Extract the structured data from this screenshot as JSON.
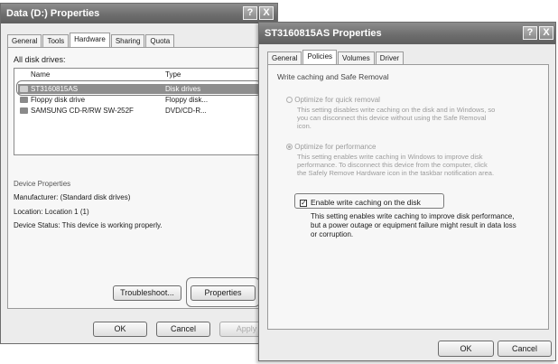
{
  "left_window": {
    "title": "Data (D:) Properties",
    "help_btn": "?",
    "close_btn": "X",
    "tabs": [
      "General",
      "Tools",
      "Hardware",
      "Sharing",
      "Quota"
    ],
    "active_tab": "Hardware",
    "all_disk_drives_label": "All disk drives:",
    "columns": {
      "name": "Name",
      "type": "Type"
    },
    "drives": [
      {
        "name": "ST3160815AS",
        "type": "Disk drives"
      },
      {
        "name": "Floppy disk drive",
        "type": "Floppy disk..."
      },
      {
        "name": "SAMSUNG CD-R/RW SW-252F",
        "type": "DVD/CD-R..."
      }
    ],
    "device_properties": {
      "heading": "Device Properties",
      "manufacturer": "Manufacturer: (Standard disk drives)",
      "location": "Location: Location 1 (1)",
      "status": "Device Status: This device is working properly."
    },
    "troubleshoot_btn": "Troubleshoot...",
    "properties_btn": "Properties",
    "ok_btn": "OK",
    "cancel_btn": "Cancel",
    "apply_btn": "Apply"
  },
  "right_window": {
    "title": "ST3160815AS Properties",
    "help_btn": "?",
    "close_btn": "X",
    "tabs": [
      "General",
      "Policies",
      "Volumes",
      "Driver"
    ],
    "active_tab": "Policies",
    "group_title": "Write caching and Safe Removal",
    "option_quick": {
      "label": "Optimize for quick removal",
      "desc": [
        "This setting disables write caching on the disk and in Windows, so",
        "you can disconnect this device without using the Safe Removal",
        "icon."
      ]
    },
    "option_perf": {
      "label": "Optimize for performance",
      "desc": [
        "This setting enables write caching in Windows to improve disk",
        "performance. To disconnect this device from the computer, click",
        "the Safely Remove Hardware icon in the taskbar notification area."
      ]
    },
    "write_cache": {
      "label": "Enable write caching on the disk",
      "checked": true,
      "desc": [
        "This setting enables write caching to improve disk performance,",
        "but a power outage or equipment failure might result in data loss",
        "or corruption."
      ]
    },
    "ok_btn": "OK",
    "cancel_btn": "Cancel"
  }
}
